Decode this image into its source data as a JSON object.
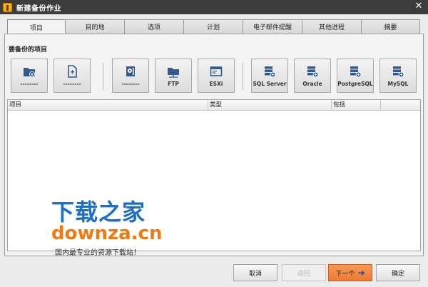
{
  "window": {
    "title": "新建备份作业"
  },
  "tabs": [
    {
      "label": "项目",
      "active": true
    },
    {
      "label": "目的地"
    },
    {
      "label": "选项"
    },
    {
      "label": "计划"
    },
    {
      "label": "电子邮件提醒"
    },
    {
      "label": "其他进程"
    },
    {
      "label": "摘要"
    }
  ],
  "section": {
    "title": "要备份的项目"
  },
  "items": [
    {
      "label": "--------",
      "icon": "folder-add-icon"
    },
    {
      "label": "--------",
      "icon": "file-add-icon"
    },
    {
      "label": "--------",
      "icon": "disk-image-icon"
    },
    {
      "label": "FTP",
      "icon": "ftp-folder-icon"
    },
    {
      "label": "ESXi",
      "icon": "esxi-window-icon"
    },
    {
      "label": "SQL Server",
      "icon": "sql-server-db-icon"
    },
    {
      "label": "Oracle",
      "icon": "oracle-db-icon"
    },
    {
      "label": "PostgreSQL",
      "icon": "postgresql-db-icon"
    },
    {
      "label": "MySQL",
      "icon": "mysql-db-icon"
    }
  ],
  "table": {
    "columns": [
      "项目",
      "类型",
      "包括",
      ""
    ]
  },
  "watermark": {
    "line1": "下载之家",
    "line2": "downza.cn",
    "line3": "国内最专业的资源下载站！"
  },
  "footer": {
    "cancel": "取消",
    "back": "返回",
    "next": "下一个",
    "ok": "确定"
  },
  "colors": {
    "primary": "#ee7a31",
    "titlebar": "#3c3c3c",
    "icon_blue": "#345a8e"
  }
}
